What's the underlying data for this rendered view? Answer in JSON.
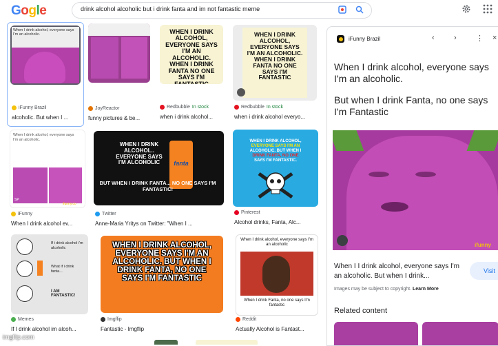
{
  "logo": {
    "letters": [
      "G",
      "o",
      "g",
      "l",
      "e"
    ],
    "colors": [
      "#4285f4",
      "#ea4335",
      "#fbbc05",
      "#34a853",
      "#ea4335"
    ]
  },
  "search": {
    "query": "drink alcohol alcoholic but i drink fanta and im not fantastic meme"
  },
  "icons": {
    "lens": "lens-icon",
    "search": "search-icon",
    "settings": "gear-icon",
    "apps": "apps-grid-icon"
  },
  "results": [
    {
      "source": "iFunny Brazil",
      "title": "alcoholic. But when I ...",
      "stock": ""
    },
    {
      "source": "JoyReactor",
      "title": "funny pictures & be...",
      "stock": ""
    },
    {
      "source": "Redbubble",
      "title": "when i drink alcohol...",
      "stock": "In stock"
    },
    {
      "source": "Redbubble",
      "title": "when i drink alcohol everyo...",
      "stock": "In stock"
    },
    {
      "source": "iFunny",
      "title": "When I drink alcohol ev...",
      "stock": ""
    },
    {
      "source": "Twitter",
      "title": "Anne-Maria Yritys on Twitter: \"When I ...",
      "stock": ""
    },
    {
      "source": "Pinterest",
      "title": "Alcohol drinks, Fanta, Alc...",
      "stock": ""
    },
    {
      "source": "Memes",
      "title": "If I drink alcohol im alcoh...",
      "stock": ""
    },
    {
      "source": "Imgflip",
      "title": "Fantastic - Imgflip",
      "stock": ""
    },
    {
      "source": "Reddit",
      "title": "Actually Alcohol is Fantast...",
      "stock": ""
    }
  ],
  "memes": {
    "small_top": "When I drink alcohol, everyone says I'm an alcoholic.",
    "small_bottom": "But when I drink Fanta, no one says I'm Fantastic",
    "cream_text": "WHEN I DRINK ALCOHOL, EVERYONE SAYS I'M AN ALCOHOLIC. WHEN I DRINK FANTA NO ONE SAYS I'M FANTASTIC",
    "cream_text2": "WHEN I DRINK ALCOHOL, EVERYONE SAYS I'M AN ALCOHOLIC. WHEN I DRINK FANTA NO ONE SAYS I'M FANTASTIC",
    "dark_top": "WHEN I DRINK ALCOHOL.. EVERYONE SAYS I'M ALCOHOLIC",
    "dark_bottom": "BUT WHEN I DRINK FANTA... NO ONE SAYS I'M FANTASTIC!",
    "can_label": "fanta",
    "blue_line1": "WHEN I DRINK ALCOHOL,",
    "blue_line2": "EVERYONE SAYS I'M AN",
    "blue_line3": "ALCOHOLIC. BUT WHEN I",
    "blue_line4": "DRINK FANTA, NO ONE",
    "blue_line5": "SAYS I'M FANTASTIC.",
    "comic_1": "If i drink alcohol i'm alcoholic",
    "comic_2": "What if i drink fanta...",
    "comic_3": "I AM FANTASTIC!",
    "orange_text": "WHEN I DRINK ALCOHOL, EVERYONE SAYS I'M AN ALCOHOLIC. BUT WHEN I DRINK FANTA, NO ONE SAYS I'M FANTASTIC",
    "reddit_top": "When I drink alcohol, everyone says I'm an alcoholic",
    "reddit_bottom": "When I drink Fanta, no one says I'm fantastic",
    "sp": "SP",
    "ifunny_wm": "ifunny.co"
  },
  "panel": {
    "source": "iFunny Brazil",
    "big_top": "When I drink alcohol, everyone says I'm an alcoholic.",
    "big_bottom": "But when I drink Fanta, no one says I'm Fantastic",
    "caption": "When I I drink alcohol, everyone says I'm an alcoholic. But when I drink...",
    "visit": "Visit",
    "copyright": "Images may be subject to copyright.",
    "learn_more": "Learn More",
    "related": "Related content",
    "wm": "ifunny"
  },
  "watermark": "imgflip.com"
}
